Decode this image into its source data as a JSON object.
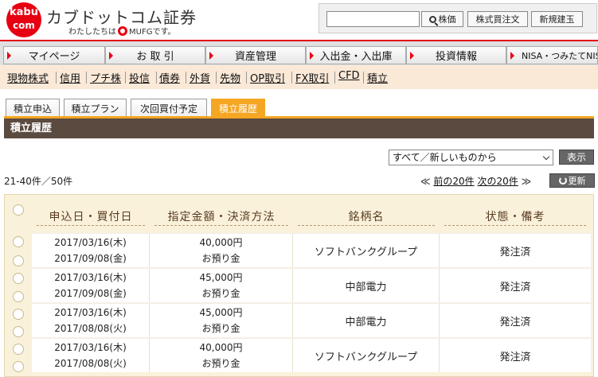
{
  "header": {
    "logo_line1": "kabu",
    "logo_line2": "com",
    "brand_name": "カブドットコム証券",
    "tagline_prefix": "わたしたちは",
    "tagline_brand": "MUFG",
    "tagline_suffix": "です。",
    "search_placeholder": "",
    "search_button": "株価",
    "order_button": "株式買注文",
    "new_position_button": "新規建玉"
  },
  "nav": {
    "items": [
      "マイページ",
      "お 取 引",
      "資産管理",
      "入出金・入出庫",
      "投資情報",
      "NISA・つみたてNISA"
    ]
  },
  "subnav": {
    "items": [
      "現物株式",
      "信用",
      "プチ株",
      "投信",
      "債券",
      "外貨",
      "先物",
      "OP取引",
      "FX取引",
      "CFD",
      "積立"
    ]
  },
  "tabs": [
    "積立申込",
    "積立プラン",
    "次回買付予定",
    "積立履歴"
  ],
  "active_tab": "積立履歴",
  "section_title": "積立履歴",
  "controls": {
    "sort_value": "すべて／新しいものから",
    "show_button": "表示",
    "range_info": "21-40件／50件",
    "prev_label": "前の20件",
    "next_label": "次の20件",
    "prev_arrow": "≪",
    "next_arrow": "≫",
    "refresh_button": "更新"
  },
  "table": {
    "headers": [
      "申込日・買付日",
      "指定金額・決済方法",
      "銘柄名",
      "状態・備考"
    ],
    "rows": [
      {
        "apply_date": "2017/03/16(木)",
        "buy_date": "2017/09/08(金)",
        "amount": "40,000円",
        "payment": "お預り金",
        "name": "ソフトバンクグループ",
        "status": "発注済"
      },
      {
        "apply_date": "2017/03/16(木)",
        "buy_date": "2017/09/08(金)",
        "amount": "45,000円",
        "payment": "お預り金",
        "name": "中部電力",
        "status": "発注済"
      },
      {
        "apply_date": "2017/03/16(木)",
        "buy_date": "2017/08/08(火)",
        "amount": "45,000円",
        "payment": "お預り金",
        "name": "中部電力",
        "status": "発注済"
      },
      {
        "apply_date": "2017/03/16(木)",
        "buy_date": "2017/08/08(火)",
        "amount": "40,000円",
        "payment": "お預り金",
        "name": "ソフトバンクグループ",
        "status": "発注済"
      }
    ]
  },
  "colors": {
    "brand_red": "#e60012",
    "tab_orange": "#f5a623",
    "title_brown": "#5b4a3f",
    "subnav_bg": "#fbe9d8"
  }
}
